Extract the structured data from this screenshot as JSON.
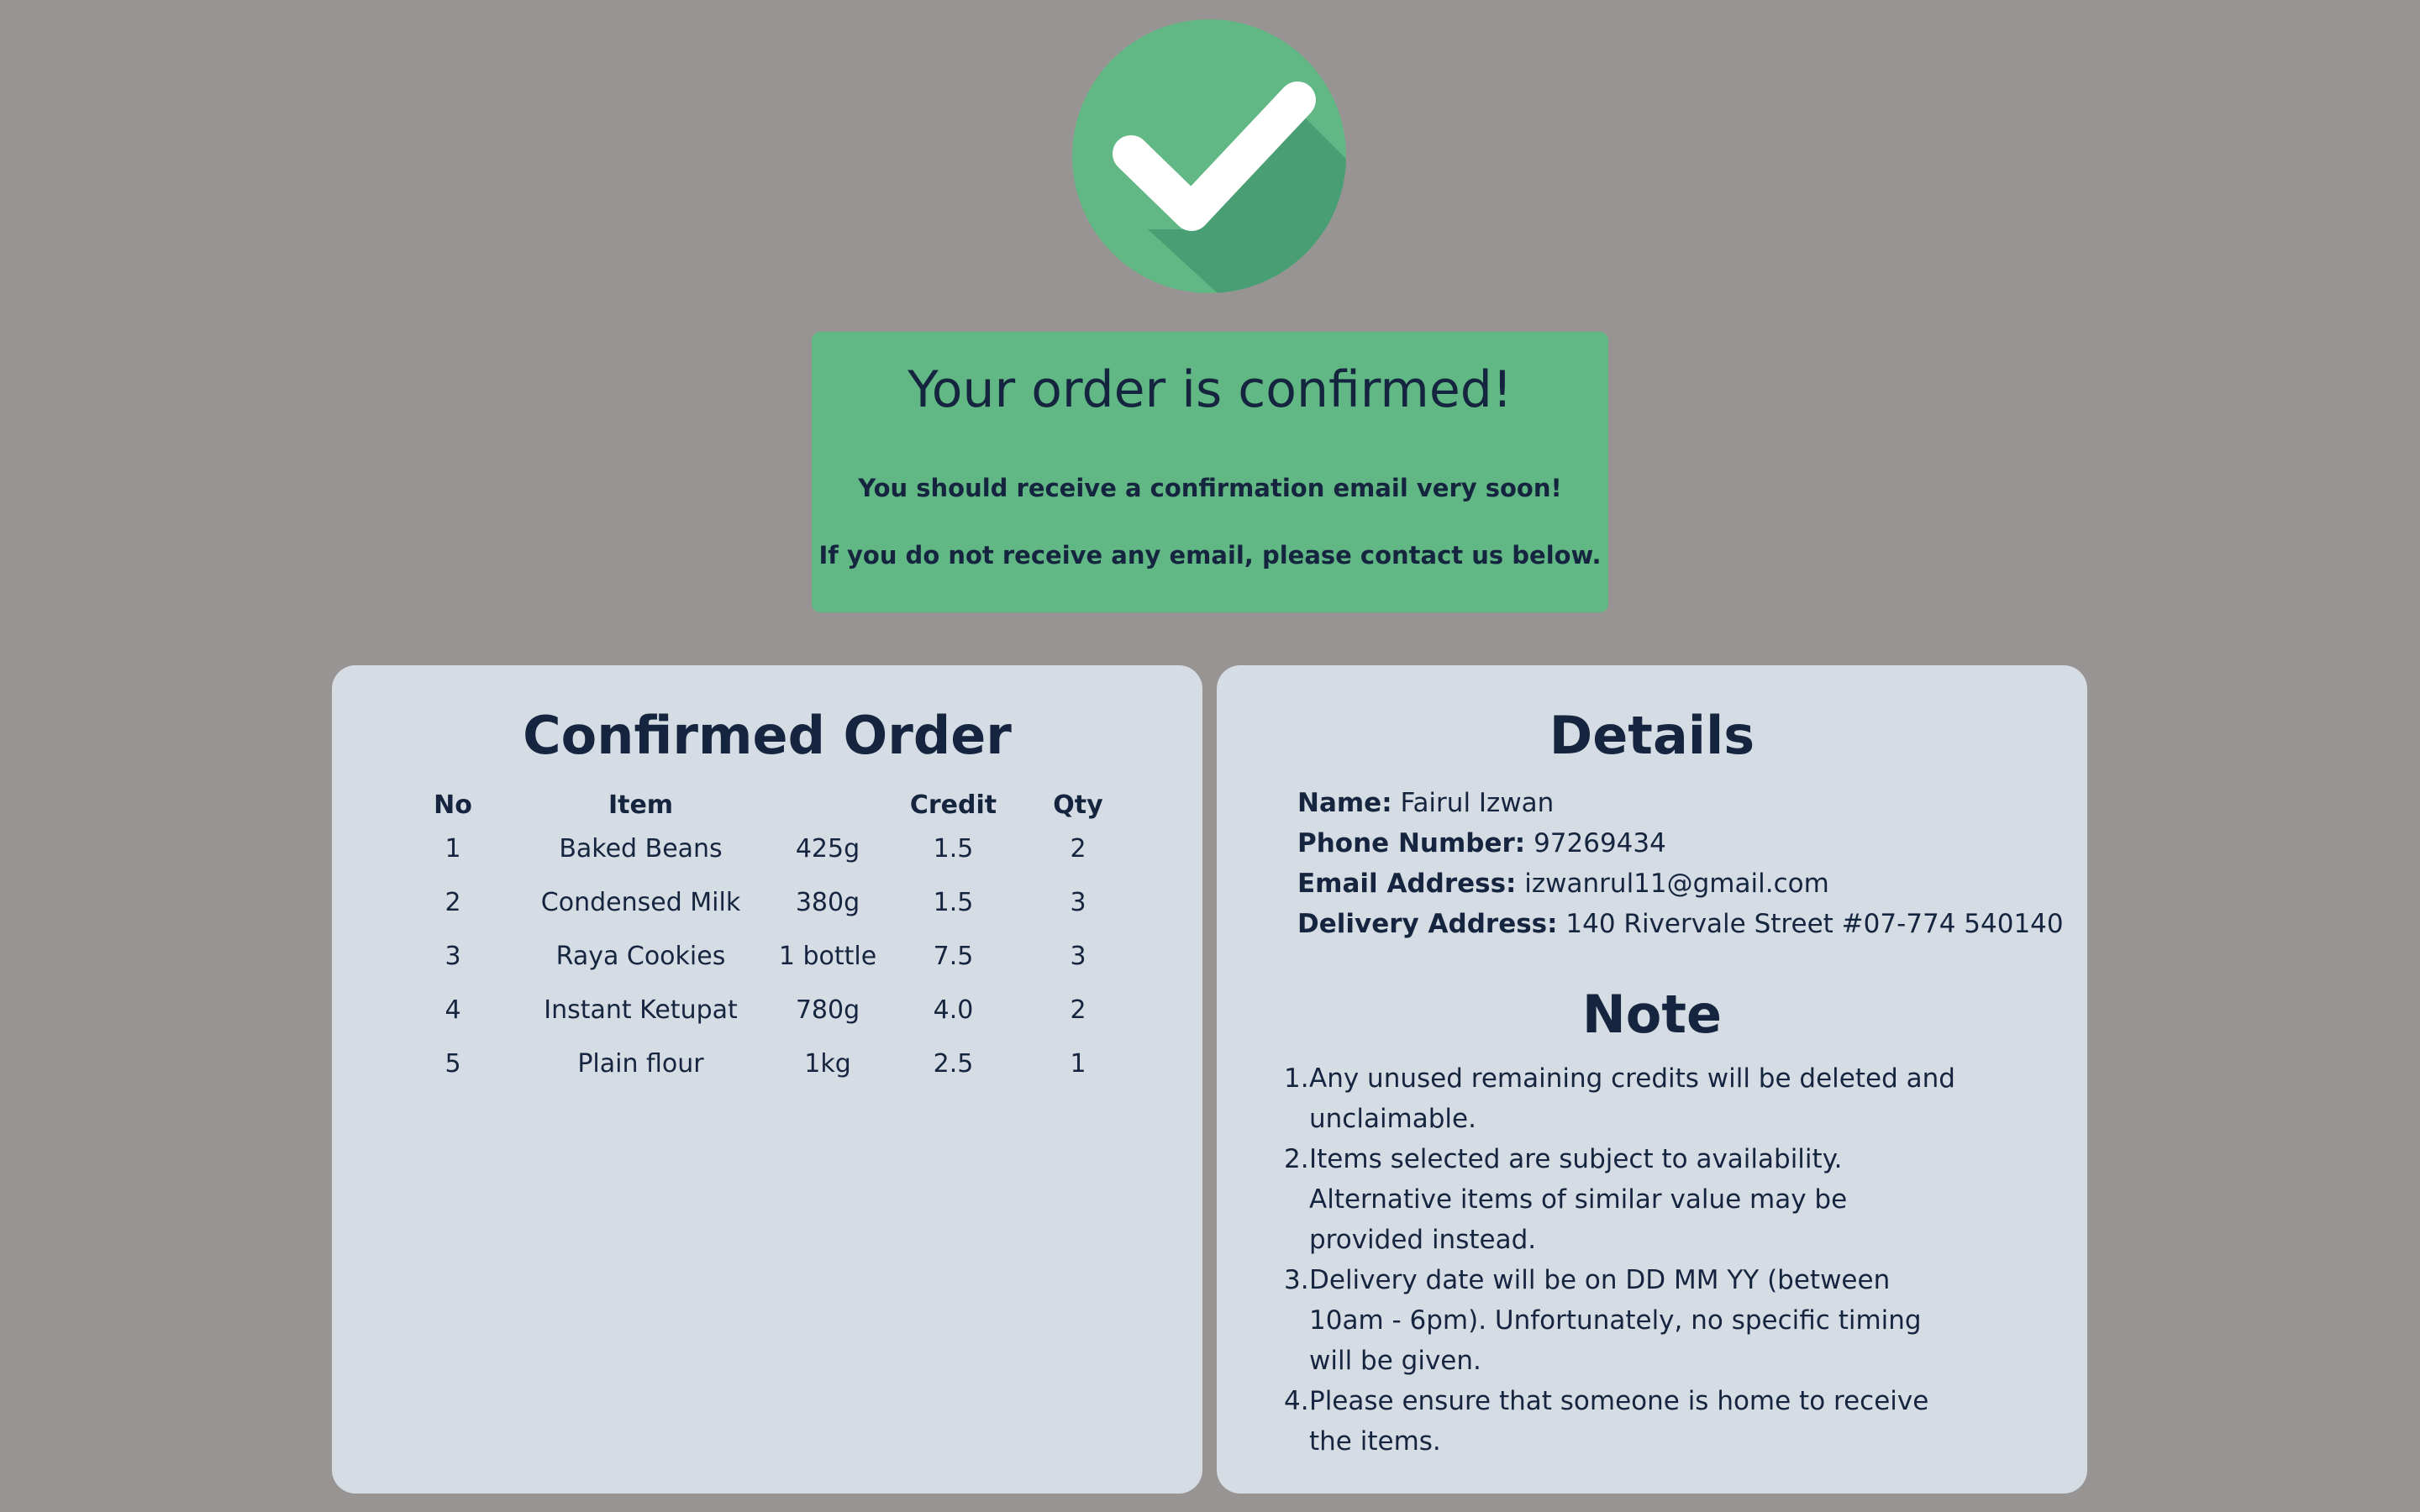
{
  "banner": {
    "title": "Your order is confirmed!",
    "line1": "You should receive a confirmation email very soon!",
    "line2": "If you do not receive any email, please contact us below."
  },
  "order": {
    "title": "Confirmed Order",
    "headers": [
      "No",
      "Item",
      "",
      "Credit",
      "Qty"
    ],
    "rows": [
      [
        "1",
        "Baked Beans",
        "425g",
        "1.5",
        "2"
      ],
      [
        "2",
        "Condensed Milk",
        "380g",
        "1.5",
        "3"
      ],
      [
        "3",
        "Raya Cookies",
        "1 bottle",
        "7.5",
        "3"
      ],
      [
        "4",
        "Instant Ketupat",
        "780g",
        "4.0",
        "2"
      ],
      [
        "5",
        "Plain flour",
        "1kg",
        "2.5",
        "1"
      ]
    ]
  },
  "details": {
    "title": "Details",
    "fields": [
      {
        "label": "Name:",
        "value": "Fairul Izwan"
      },
      {
        "label": "Phone Number:",
        "value": "97269434"
      },
      {
        "label": "Email Address:",
        "value": "izwanrul11@gmail.com"
      },
      {
        "label": "Delivery Address:",
        "value": "140 Rivervale Street #07-774 540140"
      }
    ]
  },
  "note": {
    "title": "Note",
    "items": [
      {
        "num": "1.",
        "text": "Any unused remaining credits will be deleted and unclaimable."
      },
      {
        "num": "2.",
        "text": "Items selected are subject to availability. Alternative items of similar value may be provided instead."
      },
      {
        "num": "3.",
        "text": "Delivery date will be on DD MM YY (between 10am - 6pm). Unfortunately, no specific timing will be given."
      },
      {
        "num": "4.",
        "text": "Please ensure that someone is home to receive the items."
      }
    ]
  },
  "colors": {
    "background": "#999494",
    "accent_green": "#62b884",
    "accent_green_shadow": "#4a9e73",
    "card": "#d5dce3",
    "text": "#16253f"
  },
  "icons": {
    "status": "check-circle-icon"
  }
}
